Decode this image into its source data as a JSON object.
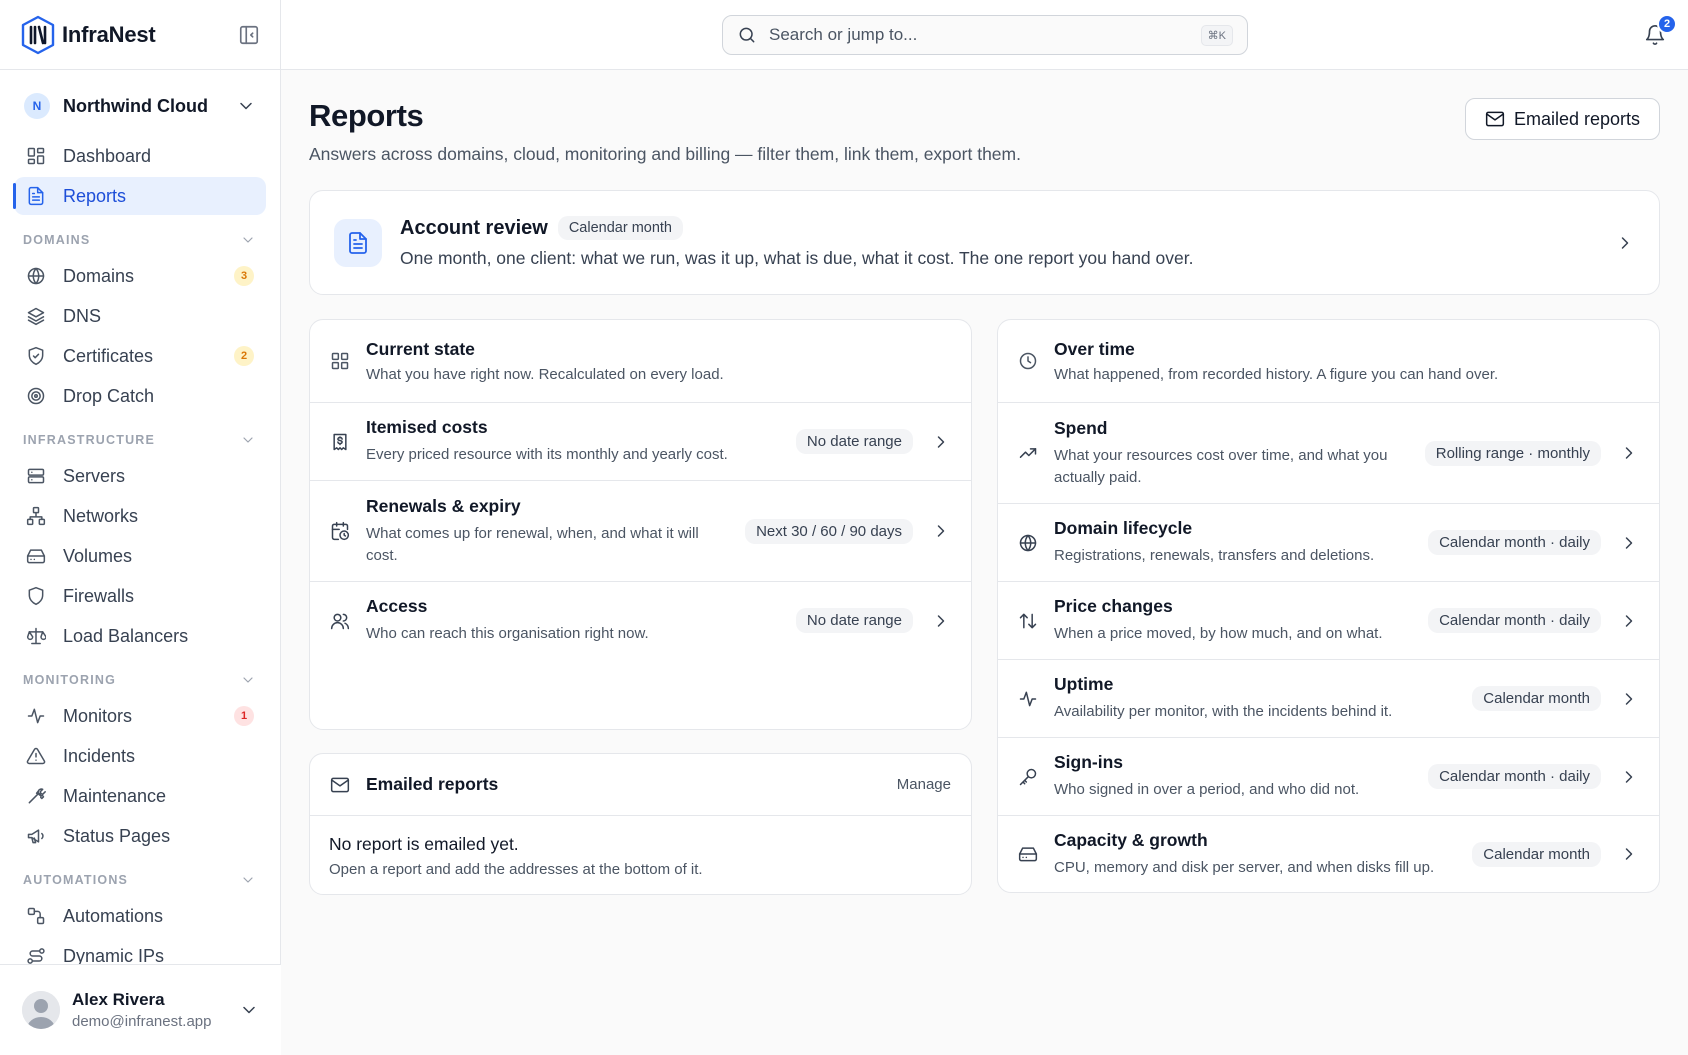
{
  "app": {
    "name": "InfraNest"
  },
  "org": {
    "initial": "N",
    "name": "Northwind Cloud"
  },
  "nav": {
    "top": [
      {
        "label": "Dashboard",
        "icon": "dashboard-icon"
      },
      {
        "label": "Reports",
        "icon": "report-icon",
        "active": true
      }
    ],
    "sections": [
      {
        "title": "DOMAINS",
        "items": [
          {
            "label": "Domains",
            "icon": "globe-icon",
            "badge": "3",
            "badge_tone": "amber"
          },
          {
            "label": "DNS",
            "icon": "layers-icon"
          },
          {
            "label": "Certificates",
            "icon": "shield-check-icon",
            "badge": "2",
            "badge_tone": "amber"
          },
          {
            "label": "Drop Catch",
            "icon": "target-icon"
          }
        ]
      },
      {
        "title": "INFRASTRUCTURE",
        "items": [
          {
            "label": "Servers",
            "icon": "server-icon"
          },
          {
            "label": "Networks",
            "icon": "network-icon"
          },
          {
            "label": "Volumes",
            "icon": "volume-icon"
          },
          {
            "label": "Firewalls",
            "icon": "shield-icon"
          },
          {
            "label": "Load Balancers",
            "icon": "scale-icon"
          }
        ]
      },
      {
        "title": "MONITORING",
        "items": [
          {
            "label": "Monitors",
            "icon": "activity-icon",
            "badge": "1",
            "badge_tone": "red"
          },
          {
            "label": "Incidents",
            "icon": "alert-triangle-icon"
          },
          {
            "label": "Maintenance",
            "icon": "wrench-icon"
          },
          {
            "label": "Status Pages",
            "icon": "megaphone-icon"
          }
        ]
      },
      {
        "title": "AUTOMATIONS",
        "items": [
          {
            "label": "Automations",
            "icon": "workflow-icon"
          },
          {
            "label": "Dynamic IPs",
            "icon": "route-icon"
          }
        ]
      }
    ]
  },
  "user": {
    "name": "Alex Rivera",
    "email": "demo@infranest.app"
  },
  "topbar": {
    "search_placeholder": "Search or jump to...",
    "shortcut": "⌘K",
    "notifications": "2"
  },
  "page": {
    "title": "Reports",
    "subtitle": "Answers across domains, cloud, monitoring and billing — filter them, link them, export them.",
    "emailed_button": "Emailed reports"
  },
  "review": {
    "title": "Account review",
    "tag": "Calendar month",
    "desc": "One month, one client: what we run, was it up, what is due, what it cost. The one report you hand over."
  },
  "current_state": {
    "title": "Current state",
    "sub": "What you have right now. Recalculated on every load.",
    "rows": [
      {
        "title": "Itemised costs",
        "desc": "Every priced resource with its monthly and yearly cost.",
        "tag": "No date range",
        "icon": "receipt-icon"
      },
      {
        "title": "Renewals & expiry",
        "desc": "What comes up for renewal, when, and what it will cost.",
        "tag": "Next 30 / 60 / 90 days",
        "icon": "calendar-clock-icon"
      },
      {
        "title": "Access",
        "desc": "Who can reach this organisation right now.",
        "tag": "No date range",
        "icon": "users-icon"
      }
    ]
  },
  "over_time": {
    "title": "Over time",
    "sub": "What happened, from recorded history. A figure you can hand over.",
    "rows": [
      {
        "title": "Spend",
        "desc": "What your resources cost over time, and what you actually paid.",
        "tag": "Rolling range · monthly",
        "icon": "trending-up-icon"
      },
      {
        "title": "Domain lifecycle",
        "desc": "Registrations, renewals, transfers and deletions.",
        "tag": "Calendar month · daily",
        "icon": "globe-icon"
      },
      {
        "title": "Price changes",
        "desc": "When a price moved, by how much, and on what.",
        "tag": "Calendar month · daily",
        "icon": "arrows-up-down-icon"
      },
      {
        "title": "Uptime",
        "desc": "Availability per monitor, with the incidents behind it.",
        "tag": "Calendar month",
        "icon": "activity-icon"
      },
      {
        "title": "Sign-ins",
        "desc": "Who signed in over a period, and who did not.",
        "tag": "Calendar month · daily",
        "icon": "key-icon"
      },
      {
        "title": "Capacity & growth",
        "desc": "CPU, memory and disk per server, and when disks fill up.",
        "tag": "Calendar month",
        "icon": "hard-drive-icon"
      }
    ]
  },
  "emailed": {
    "title": "Emailed reports",
    "manage": "Manage",
    "empty_title": "No report is emailed yet.",
    "empty_sub": "Open a report and add the addresses at the bottom of it."
  }
}
